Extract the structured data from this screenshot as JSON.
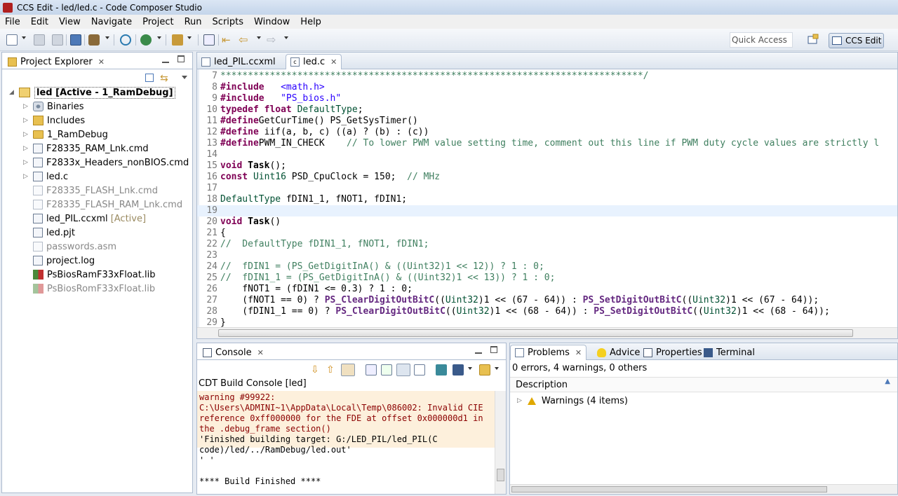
{
  "window": {
    "title": "CCS Edit - led/led.c - Code Composer Studio"
  },
  "menu": [
    "File",
    "Edit",
    "View",
    "Navigate",
    "Project",
    "Run",
    "Scripts",
    "Window",
    "Help"
  ],
  "toolbar": {
    "quick_access": "Quick Access",
    "perspective_label": "CCS Edit"
  },
  "explorer": {
    "tab_label": "Project Explorer",
    "project": {
      "name": "led",
      "status": "[Active - 1_RamDebug]"
    },
    "items": [
      {
        "label": "Binaries",
        "icon": "binaries-icon",
        "expandable": true,
        "excluded": false
      },
      {
        "label": "Includes",
        "icon": "includes-icon",
        "expandable": true,
        "excluded": false
      },
      {
        "label": "1_RamDebug",
        "icon": "folder-icon",
        "expandable": true,
        "excluded": false
      },
      {
        "label": "F28335_RAM_Lnk.cmd",
        "icon": "file-icon",
        "expandable": true,
        "excluded": false
      },
      {
        "label": "F2833x_Headers_nonBIOS.cmd",
        "icon": "file-icon",
        "expandable": true,
        "excluded": false
      },
      {
        "label": "led.c",
        "icon": "c-file-icon",
        "expandable": true,
        "excluded": false
      },
      {
        "label": "F28335_FLASH_Lnk.cmd",
        "icon": "file-icon",
        "expandable": false,
        "excluded": true
      },
      {
        "label": "F28335_FLASH_RAM_Lnk.cmd",
        "icon": "file-icon",
        "expandable": false,
        "excluded": true
      },
      {
        "label": "led_PIL.ccxml",
        "icon": "file-icon",
        "expandable": false,
        "excluded": false,
        "tag": "[Active]"
      },
      {
        "label": "led.pjt",
        "icon": "file-icon",
        "expandable": false,
        "excluded": false
      },
      {
        "label": "passwords.asm",
        "icon": "file-icon",
        "expandable": false,
        "excluded": true
      },
      {
        "label": "project.log",
        "icon": "file-icon",
        "expandable": false,
        "excluded": false
      },
      {
        "label": "PsBiosRamF33xFloat.lib",
        "icon": "lib-icon",
        "expandable": false,
        "excluded": false
      },
      {
        "label": "PsBiosRomF33xFloat.lib",
        "icon": "lib-icon",
        "expandable": false,
        "excluded": true
      }
    ]
  },
  "editor": {
    "tabs": [
      {
        "label": "led_PIL.ccxml",
        "active": false
      },
      {
        "label": "led.c",
        "active": true
      }
    ],
    "current_line": 19,
    "lines": [
      {
        "n": "7",
        "segs": [
          [
            "cm",
            "*****************************************************************************/"
          ]
        ]
      },
      {
        "n": "8",
        "segs": [
          [
            "pp",
            "#include"
          ],
          [
            "",
            "   "
          ],
          [
            "st",
            "<math.h>"
          ]
        ]
      },
      {
        "n": "9",
        "segs": [
          [
            "pp",
            "#include"
          ],
          [
            "",
            "   "
          ],
          [
            "st",
            "\"PS_bios.h\""
          ]
        ]
      },
      {
        "n": "10",
        "segs": [
          [
            "kw",
            "typedef"
          ],
          [
            "",
            " "
          ],
          [
            "kw",
            "float"
          ],
          [
            "",
            " "
          ],
          [
            "ty",
            "DefaultType"
          ],
          [
            "",
            ";"
          ]
        ]
      },
      {
        "n": "11",
        "segs": [
          [
            "pp",
            "#define"
          ],
          [
            "",
            "GetCurTime() PS_GetSysTimer()"
          ]
        ]
      },
      {
        "n": "12",
        "segs": [
          [
            "pp",
            "#define"
          ],
          [
            "",
            " iif(a, b, c) ((a) ? (b) : (c))"
          ]
        ]
      },
      {
        "n": "13",
        "segs": [
          [
            "pp",
            "#define"
          ],
          [
            "",
            "PWM_IN_CHECK    "
          ],
          [
            "cm",
            "// To lower PWM value setting time, comment out this line if PWM duty cycle values are strictly l"
          ]
        ]
      },
      {
        "n": "14",
        "segs": []
      },
      {
        "n": "15",
        "segs": [
          [
            "kw",
            "void"
          ],
          [
            "",
            " "
          ],
          [
            "fn",
            "Task"
          ],
          [
            "",
            "();"
          ]
        ]
      },
      {
        "n": "16",
        "segs": [
          [
            "kw",
            "const"
          ],
          [
            "",
            " "
          ],
          [
            "ty",
            "Uint16"
          ],
          [
            "",
            " PSD_CpuClock = 150;  "
          ],
          [
            "cm",
            "// MHz"
          ]
        ]
      },
      {
        "n": "17",
        "segs": []
      },
      {
        "n": "18",
        "segs": [
          [
            "ty",
            "DefaultType"
          ],
          [
            "",
            " fDIN1_1, fNOT1, fDIN1;"
          ]
        ]
      },
      {
        "n": "19",
        "segs": []
      },
      {
        "n": "20",
        "segs": [
          [
            "kw",
            "void"
          ],
          [
            "",
            " "
          ],
          [
            "fn",
            "Task"
          ],
          [
            "",
            "()"
          ]
        ]
      },
      {
        "n": "21",
        "segs": [
          [
            "",
            "{"
          ]
        ]
      },
      {
        "n": "22",
        "segs": [
          [
            "cm",
            "//  DefaultType fDIN1_1, fNOT1, fDIN1;"
          ]
        ]
      },
      {
        "n": "23",
        "segs": []
      },
      {
        "n": "24",
        "segs": [
          [
            "cm",
            "//  fDIN1 = (PS_GetDigitInA() & ((Uint32)1 << 12)) ? 1 : 0;"
          ]
        ]
      },
      {
        "n": "25",
        "segs": [
          [
            "cm",
            "//  fDIN1_1 = (PS_GetDigitInA() & ((Uint32)1 << 13)) ? 1 : 0;"
          ]
        ]
      },
      {
        "n": "26",
        "segs": [
          [
            "",
            "    fNOT1 = (fDIN1 <= 0.3) ? 1 : 0;"
          ]
        ]
      },
      {
        "n": "27",
        "segs": [
          [
            "",
            "    (fNOT1 == 0) ? "
          ],
          [
            "mc",
            "PS_ClearDigitOutBitC"
          ],
          [
            "",
            "(("
          ],
          [
            "ty",
            "Uint32"
          ],
          [
            "",
            ")1 << (67 - 64)) : "
          ],
          [
            "mc",
            "PS_SetDigitOutBitC"
          ],
          [
            "",
            "(("
          ],
          [
            "ty",
            "Uint32"
          ],
          [
            "",
            ")1 << (67 - 64));"
          ]
        ]
      },
      {
        "n": "28",
        "segs": [
          [
            "",
            "    (fDIN1_1 == 0) ? "
          ],
          [
            "mc",
            "PS_ClearDigitOutBitC"
          ],
          [
            "",
            "(("
          ],
          [
            "ty",
            "Uint32"
          ],
          [
            "",
            ")1 << (68 - 64)) : "
          ],
          [
            "mc",
            "PS_SetDigitOutBitC"
          ],
          [
            "",
            "(("
          ],
          [
            "ty",
            "Uint32"
          ],
          [
            "",
            ")1 << (68 - 64));"
          ]
        ]
      },
      {
        "n": "29",
        "segs": [
          [
            "",
            "}"
          ]
        ]
      }
    ]
  },
  "console": {
    "tab_label": "Console",
    "title": "CDT Build Console [led]",
    "lines": [
      {
        "text": "warning #99922:",
        "err": true
      },
      {
        "text": "C:\\Users\\ADMINI~1\\AppData\\Local\\Temp\\086002: Invalid CIE",
        "err": true
      },
      {
        "text": "reference 0xff000000 for the FDE at offset 0x000000d1 in",
        "err": true
      },
      {
        "text": "the .debug_frame section()",
        "err": true
      },
      {
        "text": "'Finished building target: G:/LED_PIL/led_PIL(C",
        "err": false
      },
      {
        "text": "code)/led/../RamDebug/led.out'",
        "err": false
      },
      {
        "text": "' '",
        "err": false
      },
      {
        "text": "",
        "err": false
      },
      {
        "text": "**** Build Finished ****",
        "err": false
      }
    ]
  },
  "problems": {
    "tabs": [
      "Problems",
      "Advice",
      "Properties",
      "Terminal"
    ],
    "summary": "0 errors, 4 warnings, 0 others",
    "column": "Description",
    "warnings_row": "Warnings (4 items)"
  },
  "colors": {
    "keyword": "#7f0055",
    "comment": "#3f7f5f",
    "string": "#2a00ff",
    "console_error": "#8b0000",
    "current_line": "#e8f2fe"
  }
}
